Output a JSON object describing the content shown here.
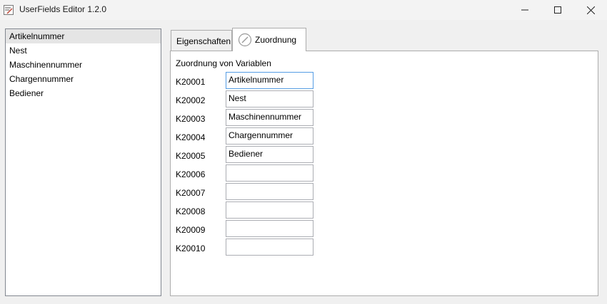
{
  "window": {
    "title": "UserFields Editor 1.2.0",
    "icon": "userfields-app-icon",
    "controls": [
      "minimize-icon",
      "maximize-icon",
      "close-icon"
    ]
  },
  "list": {
    "selected_index": 0,
    "items": [
      "Artikelnummer",
      "Nest",
      "Maschinennummer",
      "Chargennummer",
      "Bediener"
    ]
  },
  "tabs": [
    {
      "label": "Eigenschaften",
      "active": false
    },
    {
      "label": "Zuordnung",
      "active": true,
      "icon": "zuordnung-tab-icon"
    }
  ],
  "zuordnung": {
    "heading": "Zuordnung von Variablen",
    "rows": [
      {
        "key": "K20001",
        "value": "Artikelnummer"
      },
      {
        "key": "K20002",
        "value": "Nest"
      },
      {
        "key": "K20003",
        "value": "Maschinennummer"
      },
      {
        "key": "K20004",
        "value": "Chargennummer"
      },
      {
        "key": "K20005",
        "value": "Bediener"
      },
      {
        "key": "K20006",
        "value": ""
      },
      {
        "key": "K20007",
        "value": ""
      },
      {
        "key": "K20008",
        "value": ""
      },
      {
        "key": "K20009",
        "value": ""
      },
      {
        "key": "K20010",
        "value": ""
      }
    ]
  },
  "colors": {
    "window_bg": "#f0f0f0",
    "focus_border": "#569de5",
    "list_selection": "#e5e5e5"
  }
}
